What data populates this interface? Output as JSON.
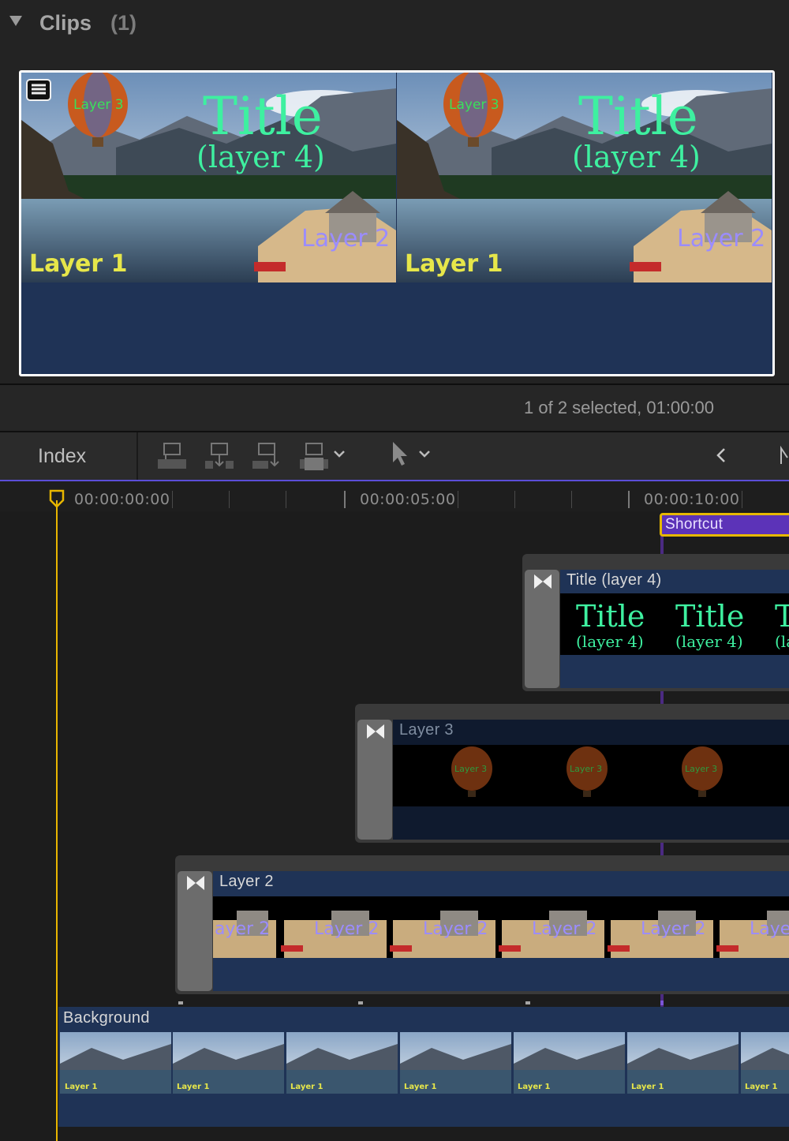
{
  "browser": {
    "section_title": "Clips",
    "section_count": "(1)",
    "thumbnails": [
      {
        "title": "Title",
        "subtitle": "(layer 4)",
        "layer1": "Layer 1",
        "layer2": "Layer 2",
        "layer3": "Layer 3"
      },
      {
        "title": "Title",
        "subtitle": "(layer 4)",
        "layer1": "Layer 1",
        "layer2": "Layer 2",
        "layer3": "Layer 3"
      }
    ]
  },
  "status": {
    "text": "1 of 2 selected, 01:00:00"
  },
  "toolbar": {
    "index_label": "Index",
    "icons": [
      "connect-clip-icon",
      "insert-clip-icon",
      "append-clip-icon",
      "overwrite-clip-icon",
      "select-tool-icon",
      "chevron-left-icon"
    ]
  },
  "ruler": {
    "timecodes": [
      "00:00:00:00",
      "00:00:05:00",
      "00:00:10:00"
    ]
  },
  "marker": {
    "label": "Shortcut"
  },
  "clips": {
    "title_clip": {
      "name": "Title (layer 4)",
      "frame_title": "Title",
      "frame_subtitle": "(layer 4)"
    },
    "layer3_clip": {
      "name": "Layer 3",
      "frame_label": "Layer 3"
    },
    "layer2_clip": {
      "name": "Layer 2",
      "frame_label": "Layer 2",
      "first_partial": "ayer 2",
      "last_partial": "Laye"
    },
    "background_clip": {
      "name": "Background",
      "frame_label": "Layer 1"
    }
  },
  "colors": {
    "timeline_accent": "#5b4ed8",
    "playhead": "#e8b600",
    "marker": "#5c33b8",
    "clip_body": "#1f3356",
    "title_text": "#3ef0a0",
    "layer_label": "#e6e64a",
    "layer2_label": "#9b8cff"
  }
}
